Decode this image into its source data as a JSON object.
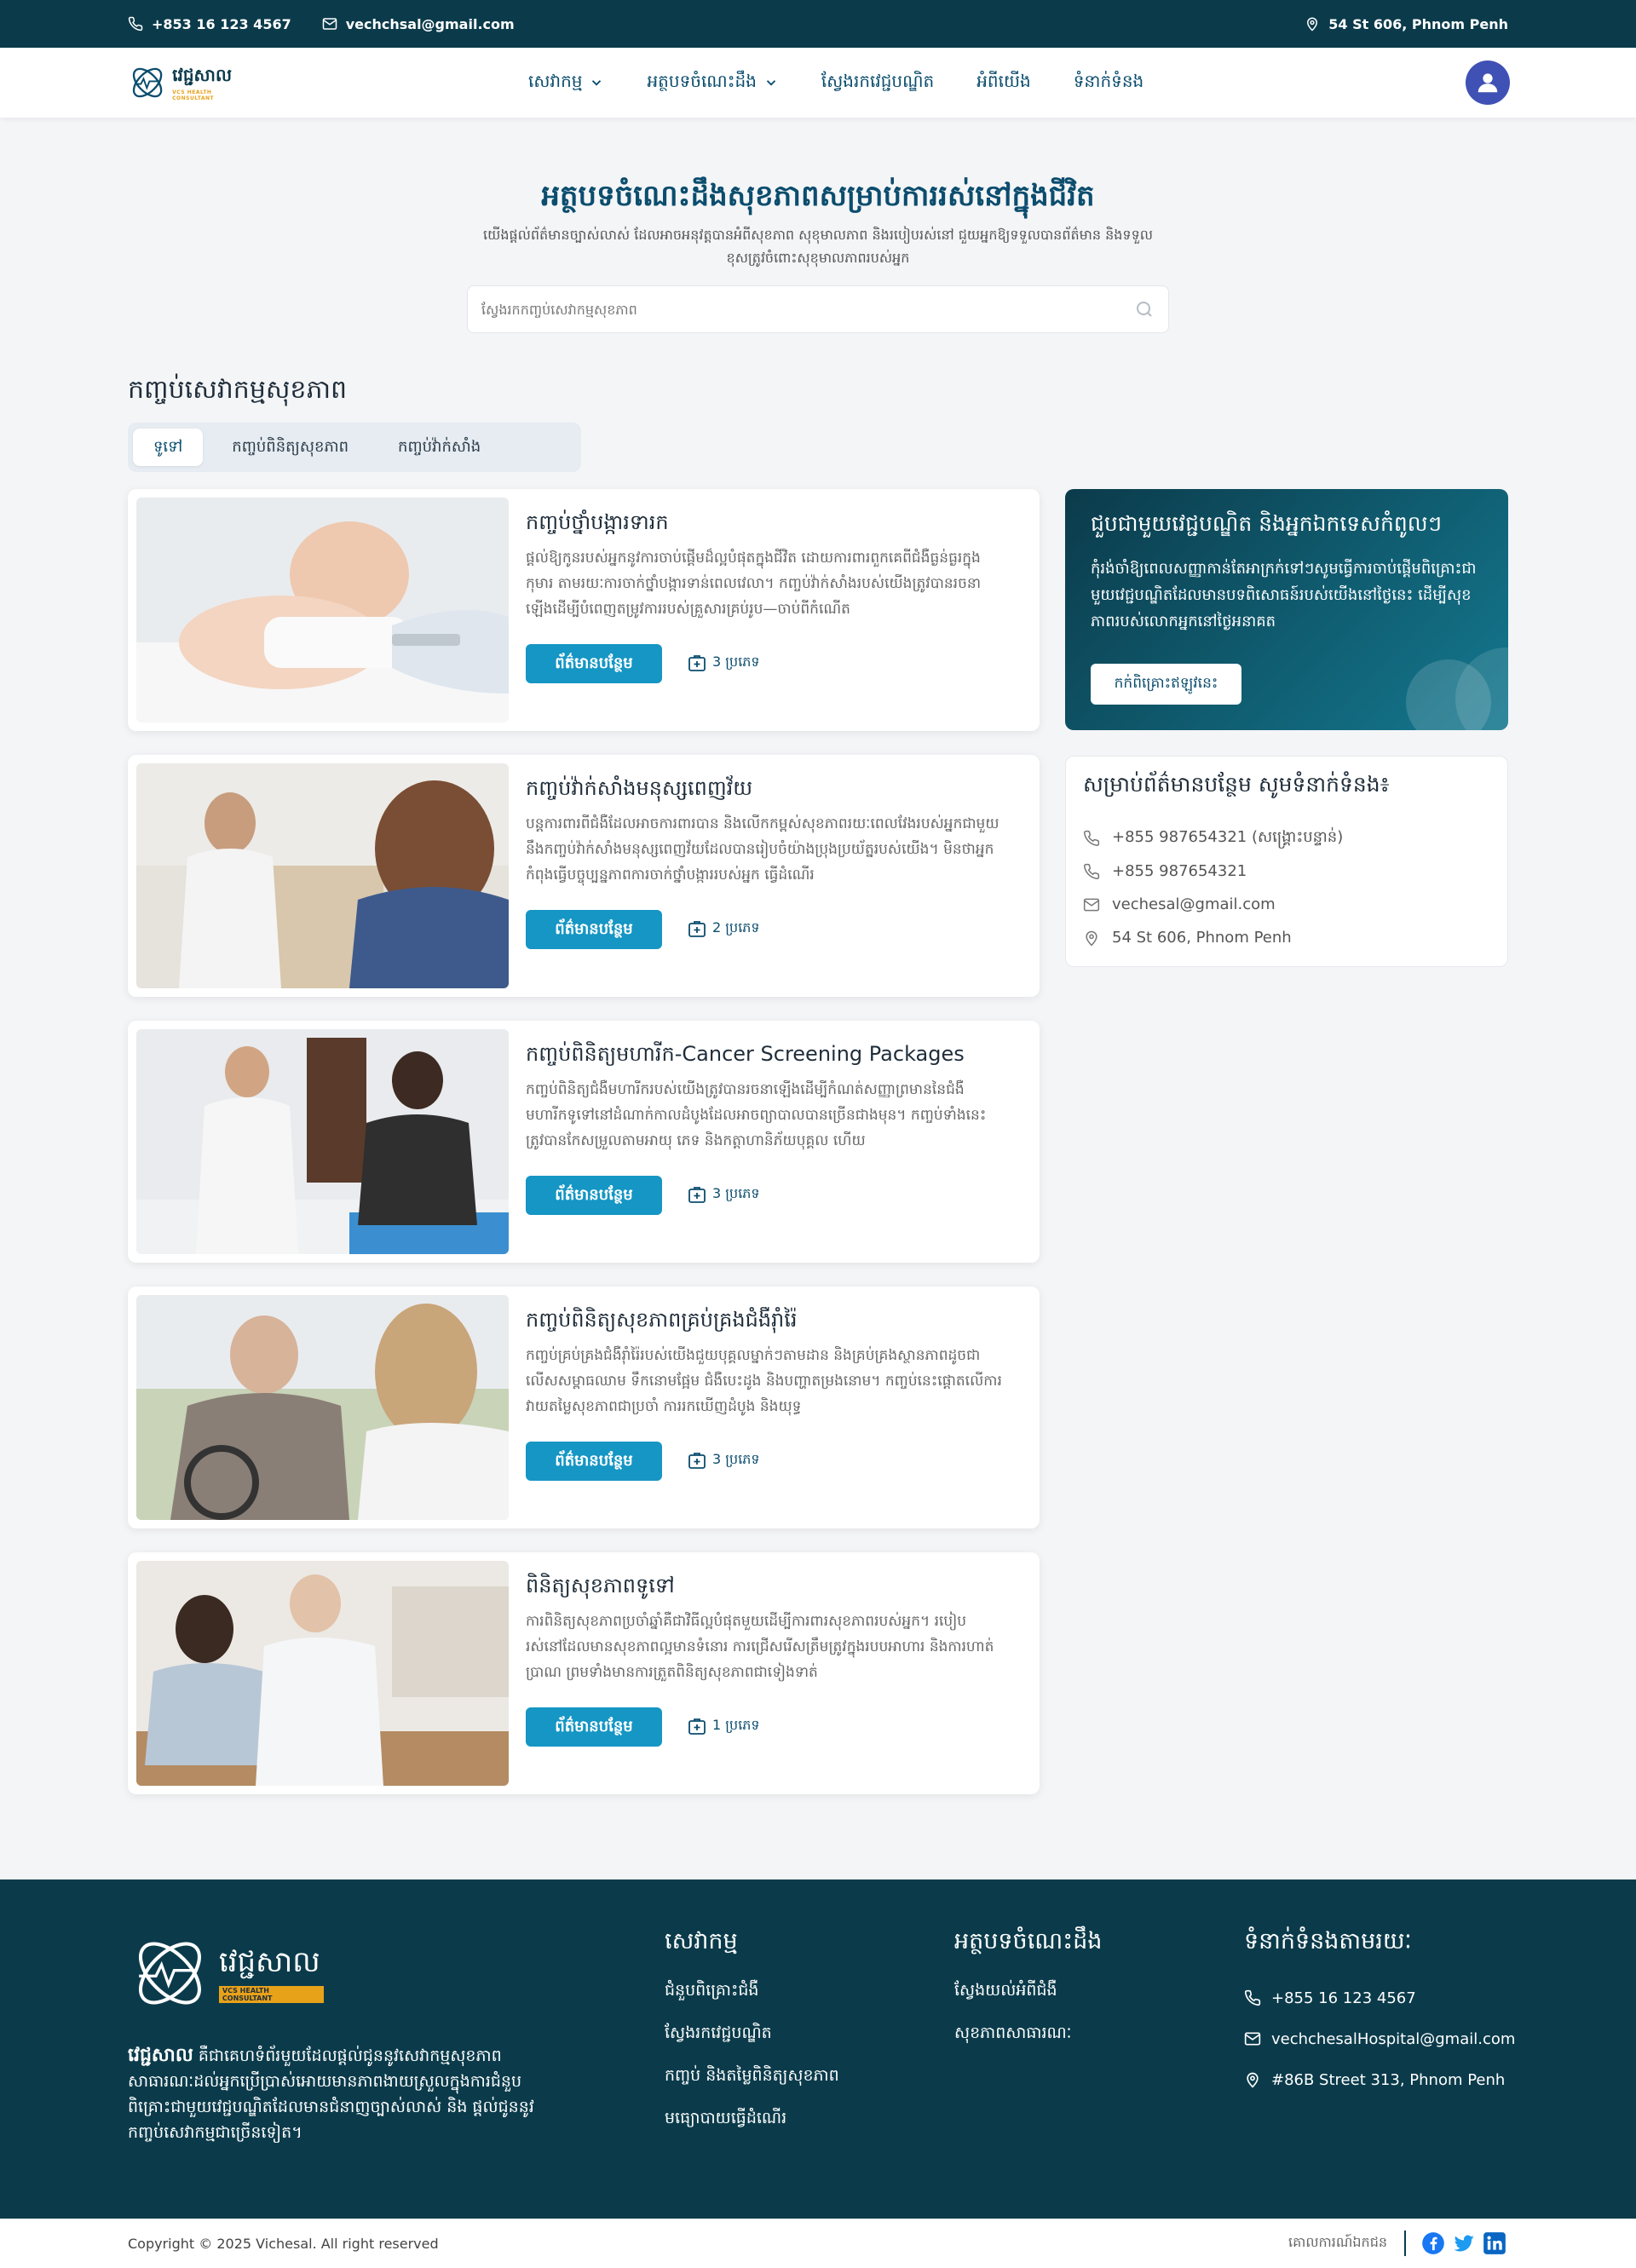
{
  "topbar": {
    "phone": "+853 16 123 4567",
    "email": "vechchsal@gmail.com",
    "address": "54 St 606, Phnom Penh"
  },
  "brand": {
    "name": "វេជ្ជសាល",
    "tagline": "VCS HEALTH CONSULTANT"
  },
  "nav": {
    "items": [
      {
        "label": "សេវាកម្ម",
        "has_dropdown": true
      },
      {
        "label": "អត្ថបទចំណេះដឹង",
        "has_dropdown": true
      },
      {
        "label": "ស្វែងរកវេជ្ជបណ្ឌិត",
        "has_dropdown": false
      },
      {
        "label": "អំពីយើង",
        "has_dropdown": false
      },
      {
        "label": "ទំនាក់ទំនង",
        "has_dropdown": false
      }
    ]
  },
  "hero": {
    "title": "អត្ថបទចំណេះដឹងសុខភាពសម្រាប់ការរស់នៅក្នុងជីវិត",
    "subtitle": "យើងផ្តល់ព័ត៌មានច្បាស់លាស់ ដែលអាចអនុវត្តបានអំពីសុខភាព សុខុមាលភាព និងរបៀបរស់នៅ ជួយអ្នកឱ្យទទួលបានព័ត៌មាន និងទទួលខុសត្រូវចំពោះសុខុមាលភាពរបស់អ្នក",
    "search_placeholder": "ស្វែងរកកញ្ចប់សេវាកម្មសុខភាព"
  },
  "section": {
    "title": "កញ្ចប់សេវាកម្មសុខភាព",
    "tabs": [
      "ទូទៅ",
      "កញ្ចប់ពិនិត្យសុខភាព",
      "កញ្ចប់វ៉ាក់សាំង"
    ],
    "active_tab": 0
  },
  "packages": [
    {
      "title": "កញ្ចប់ថ្នាំបង្ការទារក",
      "description": "ផ្តល់ឱ្យកូនរបស់អ្នកនូវការចាប់ផ្តើមដ៏ល្អបំផុតក្នុងជីវិត ដោយការពារពួកគេពីជំងឺធ្ងន់ធ្ងរក្នុងកុមារ តាមរយៈការចាក់ថ្នាំបង្ការទាន់ពេលវេលា។ កញ្ចប់វ៉ាក់សាំងរបស់យើងត្រូវបានរចនាឡើងដើម្បីបំពេញតម្រូវការរបស់គ្រួសារគ្រប់រូប—ចាប់ពីកំណើត",
      "button": "ព័ត៌មានបន្ថែម",
      "count": "3 ប្រភេទ"
    },
    {
      "title": "កញ្ចប់វ៉ាក់សាំងមនុស្សពេញវ័យ",
      "description": "បន្តការពារពីជំងឺដែលអាចការពារបាន និងលើកកម្ពស់សុខភាពរយៈពេលវែងរបស់អ្នកជាមួយនឹងកញ្ចប់វ៉ាក់សាំងមនុស្សពេញវ័យដែលបានរៀបចំយ៉ាងប្រុងប្រយ័ត្នរបស់យើង។ មិនថាអ្នកកំពុងធ្វើបច្ចុប្បន្នភាពការចាក់ថ្នាំបង្ការរបស់អ្នក ធ្វើដំណើរ",
      "button": "ព័ត៌មានបន្ថែម",
      "count": "2 ប្រភេទ"
    },
    {
      "title": "កញ្ចប់ពិនិត្យមហារីក-Cancer Screening Packages",
      "description": "កញ្ចប់ពិនិត្យជំងឺមហារីករបស់យើងត្រូវបានរចនាឡើងដើម្បីកំណត់សញ្ញាព្រមាននៃជំងឺមហារីកទូទៅនៅដំណាក់កាលដំបូងដែលអាចព្យាបាលបានច្រើនជាងមុន។ កញ្ចប់ទាំងនេះត្រូវបានកែសម្រួលតាមអាយុ ភេទ និងកត្តាហានិភ័យបុគ្គល ហើយ",
      "button": "ព័ត៌មានបន្ថែម",
      "count": "3 ប្រភេទ"
    },
    {
      "title": "កញ្ចប់ពិនិត្យសុខភាពគ្រប់គ្រងជំងឺរ៉ាំរ៉ៃ",
      "description": "កញ្ចប់គ្រប់គ្រងជំងឺរ៉ាំរ៉ៃរបស់យើងជួយបុគ្គលម្នាក់ៗតាមដាន និងគ្រប់គ្រងស្ថានភាពដូចជា លើសសម្ពាធឈាម ទឹកនោមផ្អែម ជំងឺបេះដូង និងបញ្ហាតម្រងនោម។ កញ្ចប់នេះផ្តោតលើការវាយតម្លៃសុខភាពជាប្រចាំ ការរកឃើញដំបូង និងយុទ្ធ",
      "button": "ព័ត៌មានបន្ថែម",
      "count": "3 ប្រភេទ"
    },
    {
      "title": "ពិនិត្យសុខភាពទូទៅ",
      "description": "ការពិនិត្យសុខភាពប្រចាំឆ្នាំគឺជាវិធីល្អបំផុតមួយដើម្បីការពារសុខភាពរបស់អ្នក។ របៀបរស់នៅដែលមានសុខភាពល្អមានទំនោរ ការជ្រើសរើសត្រឹមត្រូវក្នុងរបបអាហារ និងការហាត់ប្រាណ ព្រមទាំងមានការត្រួតពិនិត្យសុខភាពជាទៀងទាត់",
      "button": "ព័ត៌មានបន្ថែម",
      "count": "1 ប្រភេទ"
    }
  ],
  "meet_card": {
    "title": "ជួបជាមួយវេជ្ជបណ្ឌិត និងអ្នកឯកទេសកំពូលៗ",
    "text": "កុំរង់ចាំឱ្យពេលសញ្ញាកាន់តែអាក្រក់ទៅៗសូមធ្វើការចាប់ផ្តើមពិគ្រោះជាមួយវេជ្ជបណ្ឌិតដែលមានបទពិសោធន៍របស់យើងនៅថ្ងៃនេះ ដើម្បីសុខភាពរបស់លោកអ្នកនៅថ្ងៃអនាគត",
    "button": "កក់ពិគ្រោះឥឡូវនេះ"
  },
  "contact_card": {
    "title": "សម្រាប់ព័ត៌មានបន្ថែម សូមទំនាក់ទំនង៖",
    "items": [
      {
        "icon": "phone-icon",
        "text": "+855 987654321 (សង្គ្រោះបន្ទាន់)"
      },
      {
        "icon": "phone-icon",
        "text": "+855 987654321"
      },
      {
        "icon": "mail-icon",
        "text": "vechesal@gmail.com"
      },
      {
        "icon": "location-icon",
        "text": "54 St 606, Phnom Penh"
      }
    ]
  },
  "footer": {
    "brand_bold": "វេជ្ជសាល",
    "description": " គឺជាគេហទំព័រមួយដែលផ្តល់ជូននូវសេវាកម្មសុខភាពសាធារណៈដល់អ្នកប្រើប្រាស់អោយមានភាពងាយស្រួលក្នុងការជំនួបពិគ្រោះជាមួយវេជ្ជបណ្ឌិតដែលមានជំនាញច្បាស់លាស់ និង ផ្តល់ជូននូវកញ្ចប់សេវាកម្មជាច្រើនទៀត។",
    "services": {
      "title": "សេវាកម្ម",
      "links": [
        "ជំនួបពិគ្រោះជំងឺ",
        "ស្វែងរកវេជ្ជបណ្ឌិត",
        "កញ្ចប់ និងតម្លៃពិនិត្យសុខភាព",
        "មធ្យោបាយធ្វើដំណើរ"
      ]
    },
    "articles": {
      "title": "អត្ថបទចំណេះដឹង",
      "links": [
        "ស្វែងយល់អំពីជំងឺ",
        "សុខភាពសាធារណៈ"
      ]
    },
    "contact": {
      "title": "ទំនាក់ទំនងតាមរយៈ",
      "phone": "+855 16 123 4567",
      "email": "vechchesalHospital@gmail.com",
      "address": "#86B Street 313, Phnom Penh"
    },
    "copyright": "Copyright © 2025 Vichesal. All right reserved",
    "policy": "គោលការណ៍ឯកជន"
  },
  "colors": {
    "primary_dark": "#0b3b4b",
    "accent": "#1596c4",
    "avatar": "#3f51b5",
    "tagline": "#e8a21a"
  }
}
